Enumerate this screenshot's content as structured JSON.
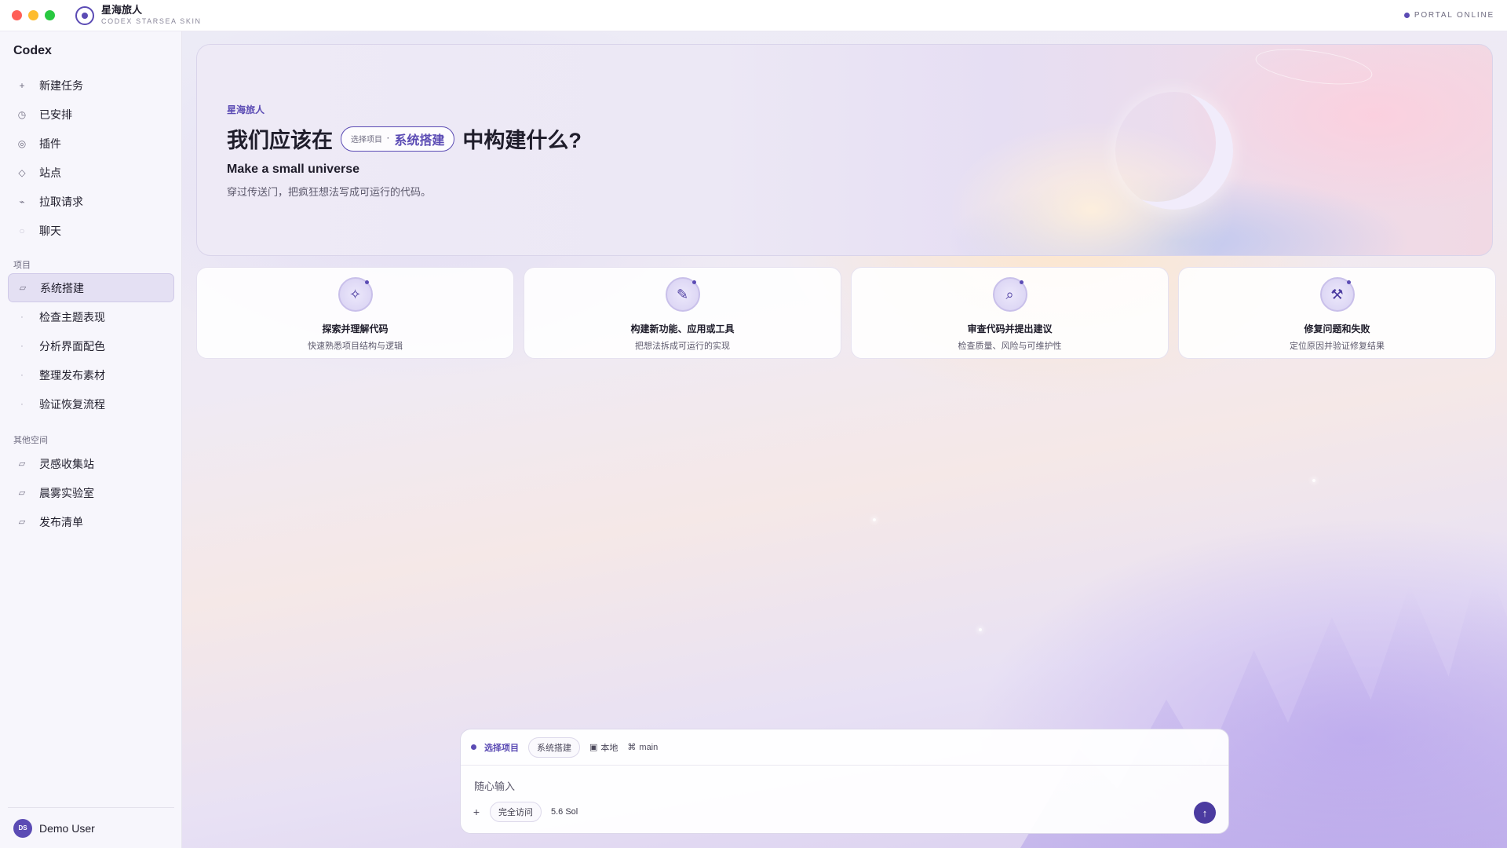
{
  "titlebar": {
    "app_title": "星海旅人",
    "app_subtitle": "CODEX STARSEA SKIN",
    "status": "PORTAL ONLINE"
  },
  "sidebar": {
    "app_name": "Codex",
    "nav": [
      {
        "icon": "plus-icon",
        "glyph": "+",
        "label": "新建任务"
      },
      {
        "icon": "clock-icon",
        "glyph": "◷",
        "label": "已安排"
      },
      {
        "icon": "plugin-icon",
        "glyph": "◎",
        "label": "插件"
      },
      {
        "icon": "diamond-icon",
        "glyph": "◇",
        "label": "站点"
      },
      {
        "icon": "pull-request-icon",
        "glyph": "⌁",
        "label": "拉取请求"
      },
      {
        "icon": "chat-icon",
        "glyph": "○",
        "label": "聊天"
      }
    ],
    "projects_label": "项目",
    "projects": [
      {
        "label": "系统搭建",
        "active": true
      },
      {
        "label": "检查主题表现"
      },
      {
        "label": "分析界面配色"
      },
      {
        "label": "整理发布素材"
      },
      {
        "label": "验证恢复流程"
      }
    ],
    "other_label": "其他空间",
    "other": [
      {
        "label": "灵感收集站"
      },
      {
        "label": "晨雾实验室"
      },
      {
        "label": "发布清单"
      }
    ],
    "user": {
      "initials": "DS",
      "name": "Demo User"
    }
  },
  "hero": {
    "kicker": "星海旅人",
    "title_before": "我们应该在",
    "pill_label": "选择项目",
    "pill_sep": "·",
    "pill_value": "系统搭建",
    "title_after": "中构建什么?",
    "subtitle": "Make a small universe",
    "description": "穿过传送门，把疯狂想法写成可运行的代码。"
  },
  "cards": [
    {
      "icon": "sparkle-icon",
      "glyph": "✧",
      "title": "探索并理解代码",
      "desc": "快速熟悉项目结构与逻辑"
    },
    {
      "icon": "pencil-icon",
      "glyph": "✎",
      "title": "构建新功能、应用或工具",
      "desc": "把想法拆成可运行的实现"
    },
    {
      "icon": "search-icon",
      "glyph": "⌕",
      "title": "审查代码并提出建议",
      "desc": "检查质量、风险与可维护性"
    },
    {
      "icon": "wrench-icon",
      "glyph": "⚒",
      "title": "修复问题和失败",
      "desc": "定位原因并验证修复结果"
    }
  ],
  "composer": {
    "project_label": "选择项目",
    "project_chip": "系统搭建",
    "env_icon": "▣",
    "env": "本地",
    "branch_icon": "⌘",
    "branch": "main",
    "placeholder": "随心输入",
    "access": "完全访问",
    "model": "5.6 Sol",
    "send_icon": "↑"
  },
  "colors": {
    "accent": "#5b4bb4"
  }
}
